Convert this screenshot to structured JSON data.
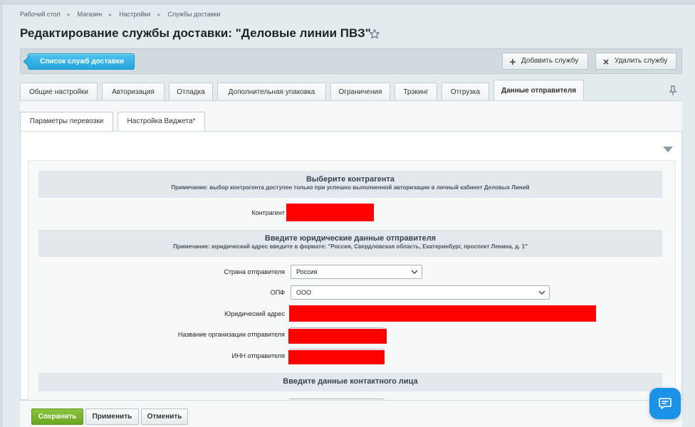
{
  "breadcrumb": [
    "Рабочий стол",
    "Магазин",
    "Настройки",
    "Службы доставки"
  ],
  "title": "Редактирование службы доставки: \"Деловые линии ПВЗ\"",
  "toolbar": {
    "list_label": "Список служб доставки",
    "add_label": "Добавить службу",
    "delete_label": "Удалить службу"
  },
  "tabs": [
    {
      "label": "Общие настройки"
    },
    {
      "label": "Авторизация"
    },
    {
      "label": "Отладка"
    },
    {
      "label": "Дополнительная упаковка"
    },
    {
      "label": "Ограничения"
    },
    {
      "label": "Трэкинг"
    },
    {
      "label": "Отгрузка"
    },
    {
      "label": "Данные отправителя",
      "active": true
    }
  ],
  "subtabs": [
    {
      "label": "Параметры перевозки"
    },
    {
      "label": "Настройка Виджета*"
    }
  ],
  "section1": {
    "title": "Выберите контрагента",
    "note": "Примечание: выбор контрагента доступен только при успешно выполненной авторизации в личный кабинет Деловых Линий",
    "contractor_label": "Контрагент"
  },
  "section2": {
    "title": "Введите юридические данные отправителя",
    "note": "Примечание: юридический адрес введите в формате: \"Россия, Свердловская область, Екатеринбург, проспект Ленина, д. 1\"",
    "country_label": "Страна отправителя",
    "country_value": "Россия",
    "opf_label": "ОПФ",
    "opf_value": "ООО",
    "address_label": "Юридический адрес",
    "org_name_label": "Название организации отправителя",
    "inn_label": "ИНН отправителя"
  },
  "section3": {
    "title": "Введите данные контактного лица"
  },
  "footer": {
    "save_label": "Сохранить",
    "apply_label": "Применить",
    "cancel_label": "Отменить"
  },
  "colors": {
    "accent_blue": "#24a5de",
    "save_green": "#6aa521",
    "redaction": "#ff0000",
    "chat_blue": "#1b92e8"
  },
  "icons": [
    "star-icon",
    "plus-icon",
    "close-icon",
    "pin-icon",
    "chevron-down-icon",
    "chat-icon"
  ]
}
